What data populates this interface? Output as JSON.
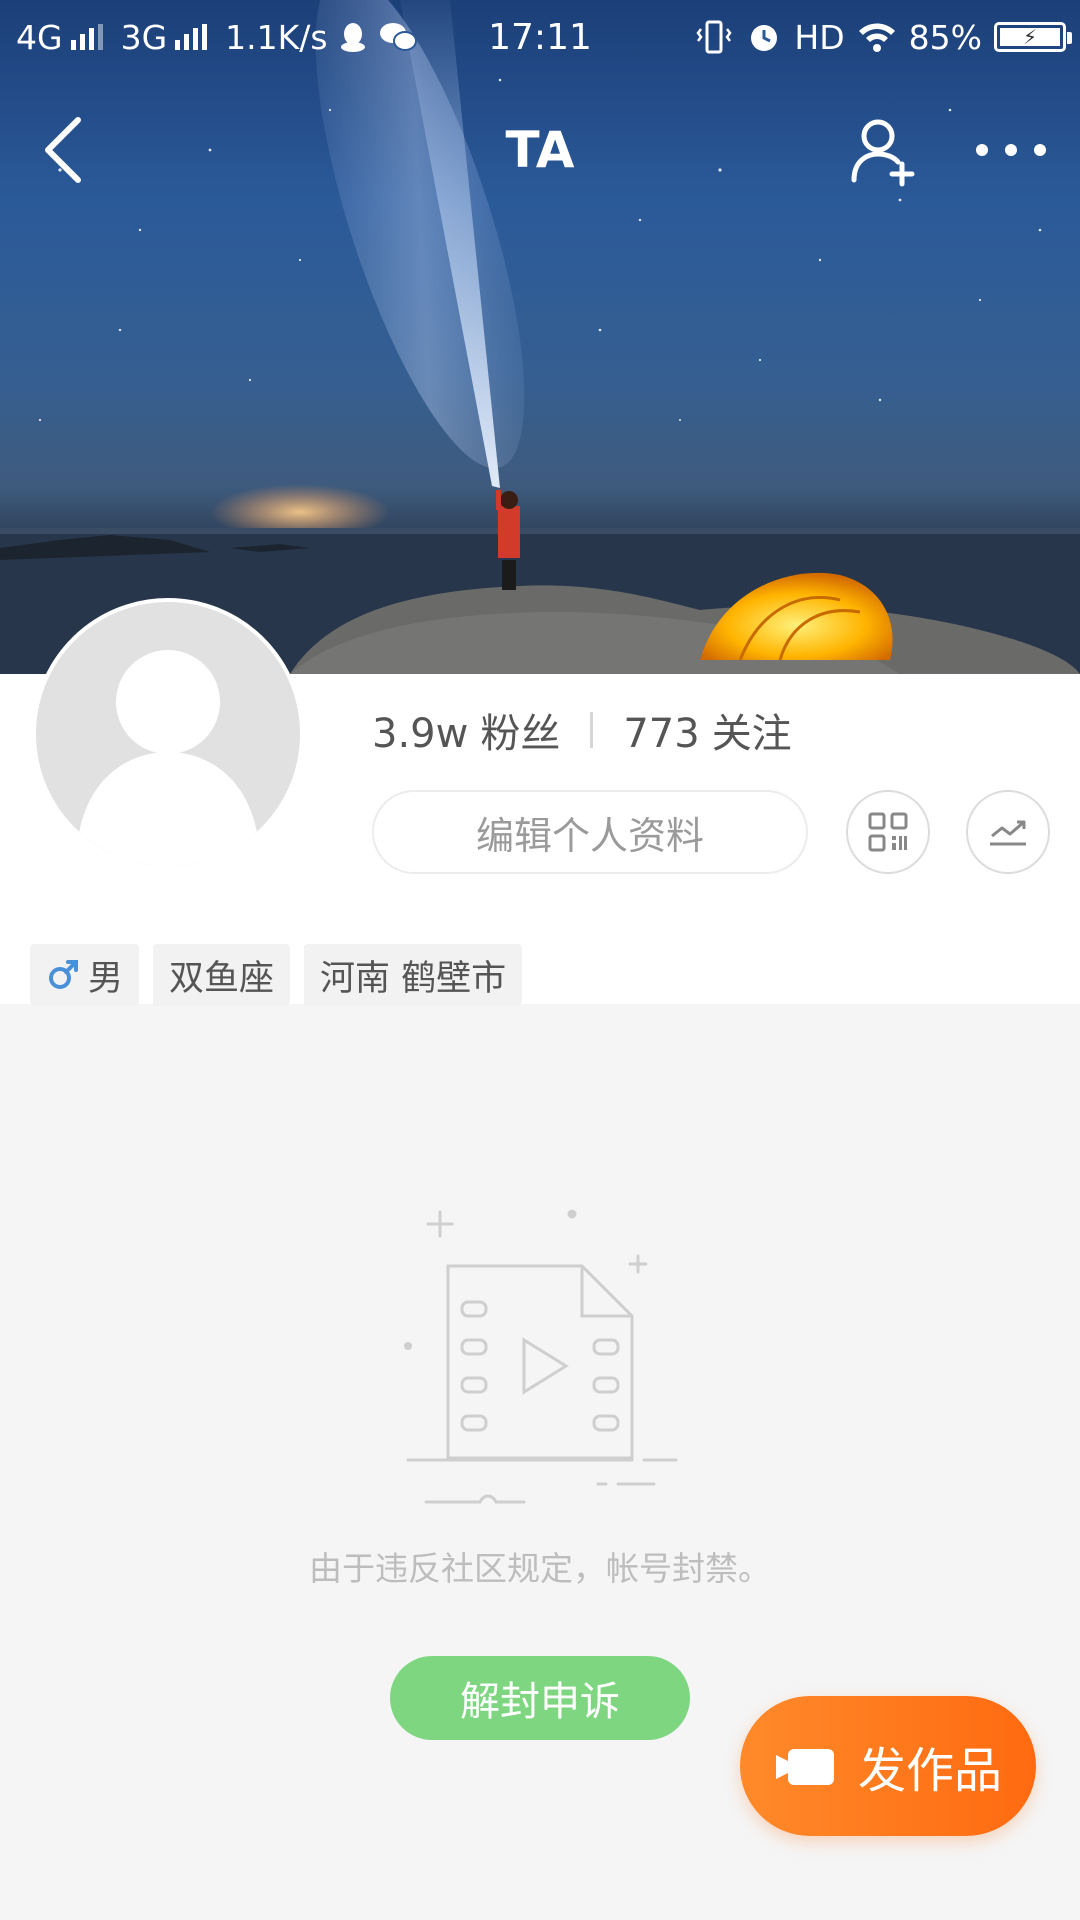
{
  "status_bar": {
    "network_1": "4G",
    "network_2": "3G",
    "speed": "1.1K/s",
    "time": "17:11",
    "hd": "HD",
    "battery": "85%",
    "icons": [
      "signal-icon",
      "qq-icon",
      "wechat-icon",
      "vibrate-icon",
      "alarm-icon",
      "wifi-icon",
      "battery-icon"
    ]
  },
  "nav": {
    "title": "TA",
    "icons": [
      "back-icon",
      "add-friend-icon",
      "more-icon"
    ]
  },
  "profile": {
    "followers_count": "3.9w",
    "followers_label": "粉丝",
    "following_count": "773",
    "following_label": "关注",
    "edit_button": "编辑个人资料",
    "action_icons": [
      "qr-code-icon",
      "trend-chart-icon"
    ],
    "tags": {
      "gender_icon": "male-icon",
      "gender": "男",
      "zodiac": "双鱼座",
      "location": "河南 鹤壁市"
    }
  },
  "empty_state": {
    "illustration": "video-file-icon",
    "message": "由于违反社区规定，帐号封禁。",
    "appeal_button": "解封申诉"
  },
  "publish": {
    "label": "发作品",
    "icon": "video-camera-icon"
  },
  "colors": {
    "appeal_green": "#7fd680",
    "publish_orange": "#ff7a1a",
    "male_blue": "#4a90d9"
  }
}
